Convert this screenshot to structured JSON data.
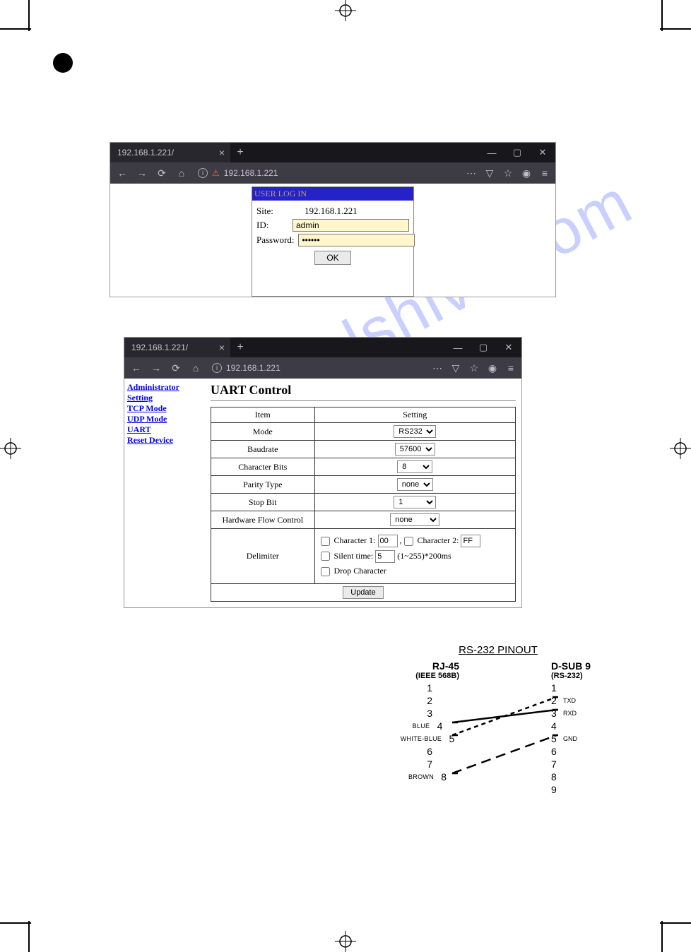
{
  "watermark_text": "manualshive.com",
  "browser1": {
    "tab_title": "192.168.1.221/",
    "url": "192.168.1.221",
    "login": {
      "title": "USER LOG IN",
      "site_label": "Site:",
      "site_value": "192.168.1.221",
      "id_label": "ID:",
      "id_value": "admin",
      "password_label": "Password:",
      "password_value": "••••••",
      "ok_label": "OK"
    }
  },
  "browser2": {
    "tab_title": "192.168.1.221/",
    "url": "192.168.1.221",
    "sidebar": {
      "link1": "Administrator Setting",
      "link2": "TCP Mode",
      "link3": "UDP Mode",
      "link4": "UART",
      "link5": "Reset Device"
    },
    "page_title": "UART Control",
    "headers": {
      "item": "Item",
      "setting": "Setting"
    },
    "rows": {
      "mode": {
        "label": "Mode",
        "value": "RS232"
      },
      "baudrate": {
        "label": "Baudrate",
        "value": "57600"
      },
      "charbits": {
        "label": "Character Bits",
        "value": "8"
      },
      "parity": {
        "label": "Parity Type",
        "value": "none"
      },
      "stopbit": {
        "label": "Stop Bit",
        "value": "1"
      },
      "hwflow": {
        "label": "Hardware Flow Control",
        "value": "none"
      },
      "delimiter": {
        "label": "Delimiter"
      }
    },
    "delimiter": {
      "char1_label": "Character 1:",
      "char1_value": "00",
      "char2_label": "Character 2:",
      "char2_value": "FF",
      "silent_label": "Silent time:",
      "silent_value": "5",
      "silent_suffix": "(1~255)*200ms",
      "drop_label": "Drop Character"
    },
    "update_label": "Update"
  },
  "pinout": {
    "title": "RS-232 PINOUT",
    "left": {
      "h1": "RJ-45",
      "h2": "(IEEE 568B)",
      "pins": [
        "1",
        "2",
        "3",
        "4",
        "5",
        "6",
        "7",
        "8"
      ],
      "colors": {
        "4": "BLUE",
        "5": "WHITE-BLUE",
        "8": "BROWN"
      }
    },
    "right": {
      "h1": "D-SUB 9",
      "h2": "(RS-232)",
      "pins": [
        "1",
        "2",
        "3",
        "4",
        "5",
        "6",
        "7",
        "8",
        "9"
      ],
      "labels": {
        "2": "TXD",
        "3": "RXD",
        "5": "GND"
      }
    }
  }
}
